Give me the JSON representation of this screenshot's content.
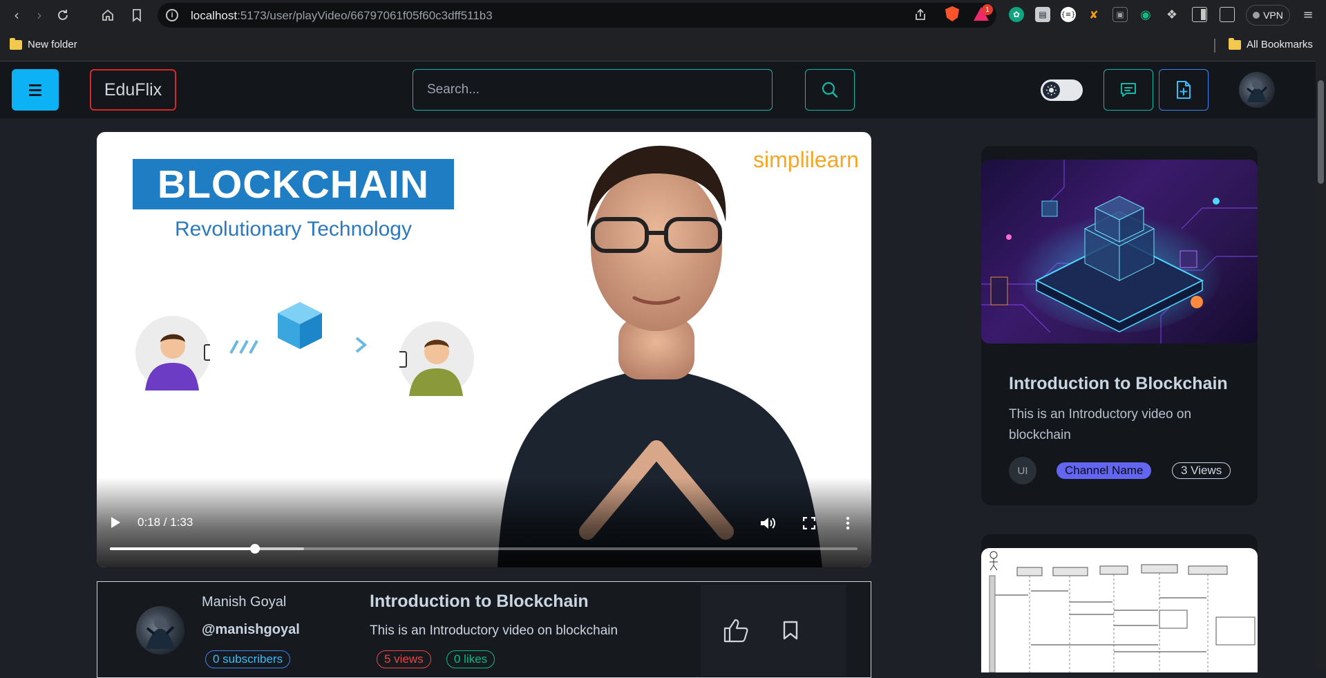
{
  "browser": {
    "url_host": "localhost",
    "url_path": ":5173/user/playVideo/66797061f05f60c3dff511b3",
    "notification_count": "1",
    "vpn_label": "VPN",
    "bookmarks": [
      "New folder"
    ],
    "all_bookmarks_label": "All Bookmarks"
  },
  "header": {
    "logo": "EduFlix",
    "search_placeholder": "Search..."
  },
  "player": {
    "slide_title": "BLOCKCHAIN",
    "slide_subtitle": "Revolutionary Technology",
    "brand": "simplilearn",
    "current_time": "0:18",
    "duration": "1:33",
    "time_display": "0:18 / 1:33",
    "played_fraction": 0.194,
    "buffered_fraction": 0.26
  },
  "video_info": {
    "channel_name": "Manish Goyal",
    "channel_handle": "@manishgoyal",
    "subscribers": "0 subscribers",
    "title": "Introduction to Blockchain",
    "description": "This is an Introductory video on blockchain",
    "views": "5 views",
    "likes": "0 likes"
  },
  "recommendations": [
    {
      "title": "Introduction to Blockchain",
      "description": "This is an Introductory video on blockchain",
      "avatar_initials": "UI",
      "channel": "Channel Name",
      "views": "3 Views"
    }
  ],
  "colors": {
    "accent_cyan": "#0cb2f4",
    "accent_teal": "#14b8a6",
    "logo_border": "#dc2626",
    "channel_pill": "#6366f1"
  }
}
